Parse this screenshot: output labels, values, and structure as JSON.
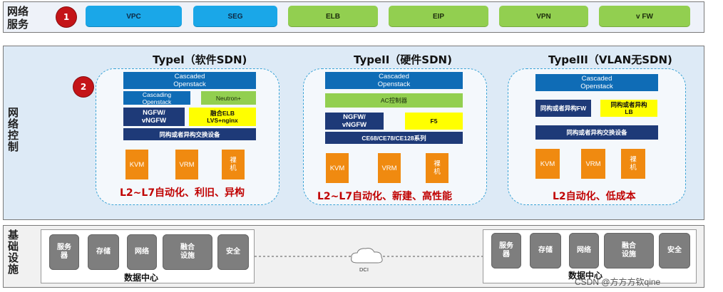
{
  "layers": {
    "services": "网络服务",
    "control": "网络控制",
    "infra": "基础设施"
  },
  "badges": [
    "1",
    "2"
  ],
  "services": [
    {
      "label": "VPC",
      "color": "#1aa7e8"
    },
    {
      "label": "SEG",
      "color": "#1aa7e8"
    },
    {
      "label": "ELB",
      "color": "#92cf50"
    },
    {
      "label": "EIP",
      "color": "#92cf50"
    },
    {
      "label": "VPN",
      "color": "#92cf50"
    },
    {
      "label": "v FW",
      "color": "#92cf50"
    }
  ],
  "types": [
    {
      "title": "TypeI（软件SDN)",
      "cascaded": "Cascaded\nOpenstack",
      "cascading": "Cascading\nOpenstack",
      "neutron": "Neutron+",
      "ngfw": "NGFW/\nvNGFW",
      "elb": "融合ELB\nLVS+nginx",
      "switch": "同构或者异构交换设备",
      "compute": [
        "KVM",
        "VRM",
        "裸\n机"
      ],
      "slogan": "L2~L7自动化、利旧、异构"
    },
    {
      "title": "TypeII（硬件SDN)",
      "cascaded": "Cascaded\nOpenstack",
      "ac": "AC控制器",
      "ngfw": "NGFW/\nvNGFW",
      "f5": "F5",
      "switch": "CE68/CE78/CE128系列",
      "compute": [
        "KVM",
        "VRM",
        "裸\n机"
      ],
      "slogan": "L2~L7自动化、新建、高性能"
    },
    {
      "title": "TypeIII（VLAN无SDN)",
      "cascaded": "Cascaded\nOpenstack",
      "fw": "同构或者异构FW",
      "lb": "同构或者异构\nLB",
      "switch": "同构或者异构交换设备",
      "compute": [
        "KVM",
        "VRM",
        "裸\n机"
      ],
      "slogan": "L2自动化、低成本"
    }
  ],
  "infra": {
    "left_boxes": [
      "服务\n器",
      "存储",
      "网络",
      "融合\n设施",
      "安全"
    ],
    "right_boxes": [
      "服务\n器",
      "存储",
      "网络",
      "融合\n设施",
      "安全"
    ],
    "dc_label": "数据中心",
    "dci": "DCI"
  },
  "watermark": "CSDN @方方方钦qine",
  "colors": {
    "badge": "#c41418",
    "cascaded": "#0f6cb6",
    "navy": "#1e3a78",
    "green": "#92cf50",
    "yellow": "#ffff00",
    "orange": "#f08a10",
    "slogan": "#c00000",
    "dc_box": "#7e7e7e"
  }
}
